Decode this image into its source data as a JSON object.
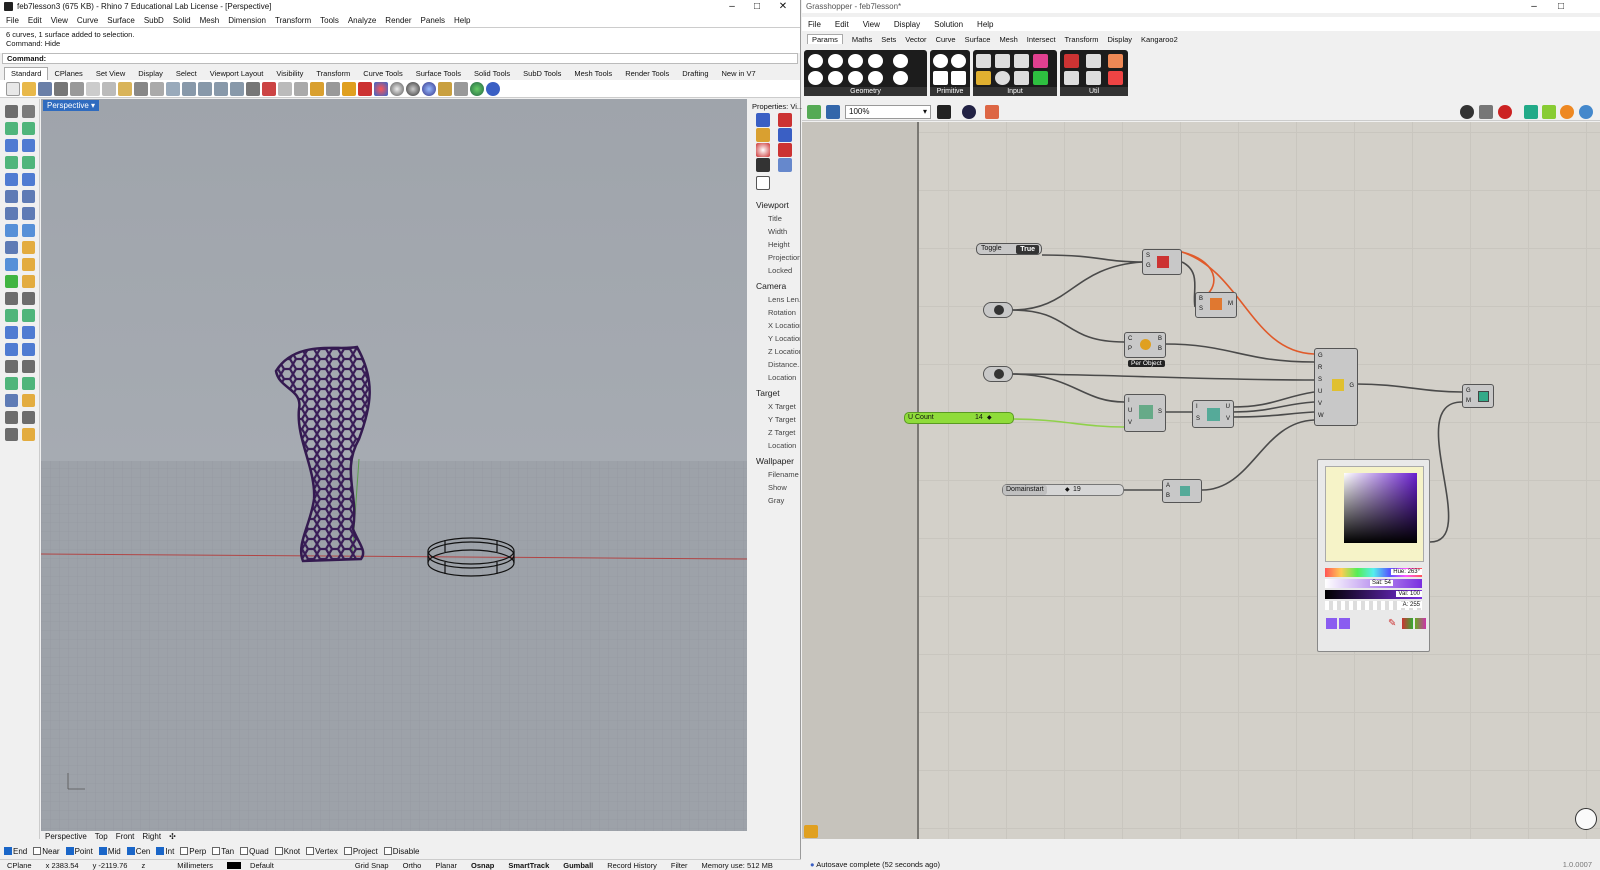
{
  "rhino": {
    "title": "feb7lesson3 (675 KB) - Rhino 7 Educational Lab License - [Perspective]",
    "menu": [
      "File",
      "Edit",
      "View",
      "Curve",
      "Surface",
      "SubD",
      "Solid",
      "Mesh",
      "Dimension",
      "Transform",
      "Tools",
      "Analyze",
      "Render",
      "Panels",
      "Help"
    ],
    "history": [
      "6 curves, 1 surface added to selection.",
      "Command: Hide"
    ],
    "command_prompt": "Command:",
    "toolbar_tabs": [
      "Standard",
      "CPlanes",
      "Set View",
      "Display",
      "Select",
      "Viewport Layout",
      "Visibility",
      "Transform",
      "Curve Tools",
      "Surface Tools",
      "Solid Tools",
      "SubD Tools",
      "Mesh Tools",
      "Render Tools",
      "Drafting",
      "New in V7"
    ],
    "viewport_label": "Perspective",
    "viewport_tabs": [
      "Perspective",
      "Top",
      "Front",
      "Right"
    ],
    "properties": {
      "header": "Properties: Vi...",
      "sections": [
        {
          "title": "Viewport",
          "items": [
            "Title",
            "Width",
            "Height",
            "Projection",
            "Locked"
          ]
        },
        {
          "title": "Camera",
          "items": [
            "Lens Len...",
            "Rotation",
            "X Location",
            "Y Location",
            "Z Location",
            "Distance...",
            "Location"
          ]
        },
        {
          "title": "Target",
          "items": [
            "X Target",
            "Y Target",
            "Z Target",
            "Location"
          ]
        },
        {
          "title": "Wallpaper",
          "items": [
            "Filename",
            "Show",
            "Gray"
          ]
        }
      ]
    },
    "osnaps": [
      {
        "label": "End",
        "on": true
      },
      {
        "label": "Near",
        "on": false
      },
      {
        "label": "Point",
        "on": true
      },
      {
        "label": "Mid",
        "on": true
      },
      {
        "label": "Cen",
        "on": true
      },
      {
        "label": "Int",
        "on": true
      },
      {
        "label": "Perp",
        "on": false
      },
      {
        "label": "Tan",
        "on": false
      },
      {
        "label": "Quad",
        "on": false
      },
      {
        "label": "Knot",
        "on": false
      },
      {
        "label": "Vertex",
        "on": false
      },
      {
        "label": "Project",
        "on": false
      },
      {
        "label": "Disable",
        "on": false
      }
    ],
    "status": {
      "cplane": "CPlane",
      "x": "x 2383.54",
      "y": "y -2119.76",
      "z": "z",
      "units": "Millimeters",
      "layer": "Default",
      "items": [
        "Grid Snap",
        "Ortho",
        "Planar",
        "Osnap",
        "SmartTrack",
        "Gumball",
        "Record History",
        "Filter"
      ],
      "memory": "Memory use: 512 MB"
    }
  },
  "gh": {
    "title": "Grasshopper - feb7lesson*",
    "menu": [
      "File",
      "Edit",
      "View",
      "Display",
      "Solution",
      "Help"
    ],
    "tabs": [
      "Params",
      "Maths",
      "Sets",
      "Vector",
      "Curve",
      "Surface",
      "Mesh",
      "Intersect",
      "Transform",
      "Display",
      "Kangaroo2"
    ],
    "groups": [
      "Geometry",
      "Primitive",
      "Input",
      "Util"
    ],
    "zoom": "100%",
    "toggle": {
      "label": "Toggle",
      "value": "True"
    },
    "ucount": {
      "label": "U Count",
      "value": "14"
    },
    "domainstart": {
      "label": "Domainstart",
      "value": "19"
    },
    "per_object": "Per Object",
    "picker": {
      "hue": "Hue: 263°",
      "sat": "Sat: 54",
      "val": "Val: 100",
      "alpha": "A: 255"
    },
    "status": "Autosave complete (52 seconds ago)",
    "version": "1.0.0007",
    "colors": {
      "wire": "#4a4a4a",
      "selected_wire": "#e05a2a",
      "slider_green": "#8fdc3a",
      "purple": "#5a1fb0"
    }
  }
}
